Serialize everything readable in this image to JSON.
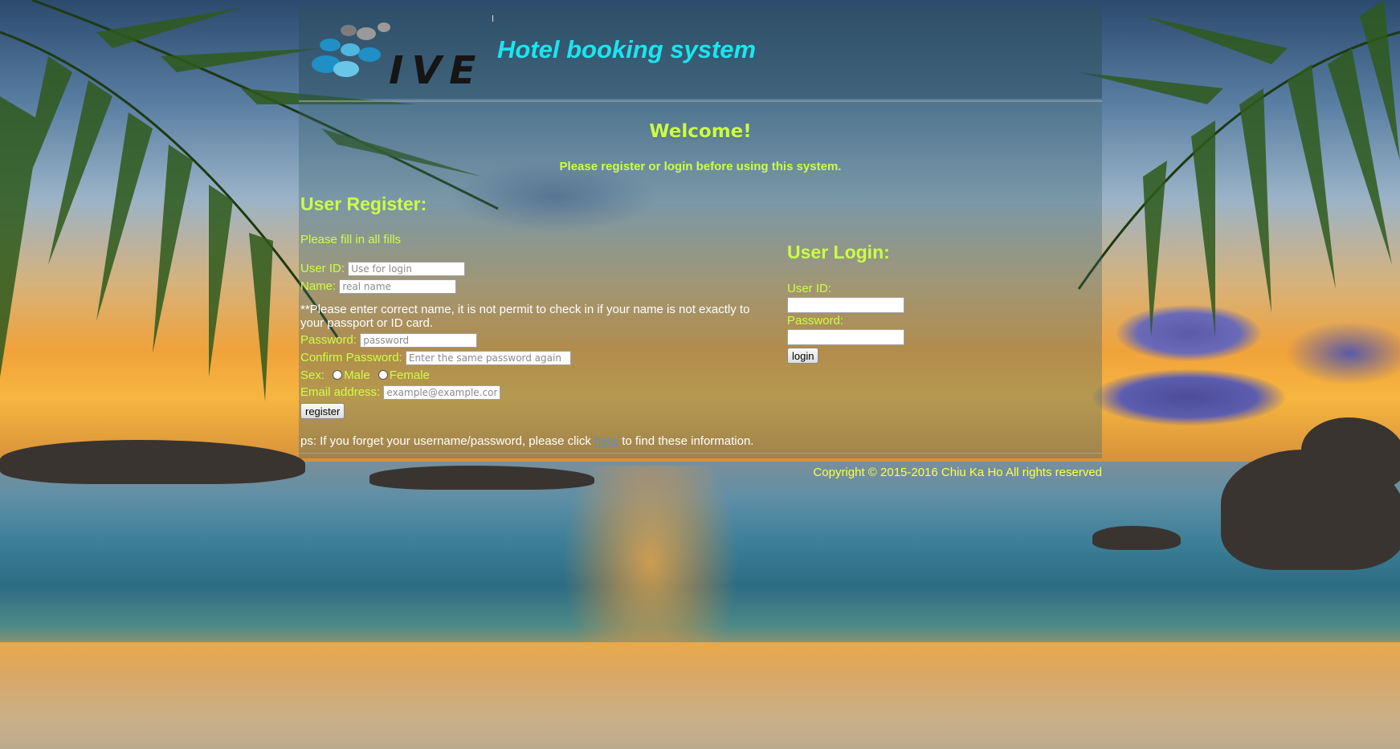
{
  "header": {
    "logo_text": "IVE",
    "title": "Hotel booking system"
  },
  "welcome": {
    "heading": "Welcome!",
    "subtitle": "Please register or login before using this system."
  },
  "register": {
    "title": "User Register:",
    "instruction": "Please fill in all fills",
    "user_id_label": "User ID:",
    "user_id_placeholder": "Use for login",
    "name_label": "Name:",
    "name_placeholder": "real name",
    "name_note": "**Please enter correct name, it is not permit to check in if your name is not exactly to your passport or ID card.",
    "password_label": "Password:",
    "password_placeholder": "password",
    "confirm_label": "Confirm Password:",
    "confirm_placeholder": "Enter the same password again",
    "sex_label": "Sex:",
    "sex_options": [
      "Male",
      "Female"
    ],
    "email_label": "Email address:",
    "email_placeholder": "example@example.com",
    "submit_label": "register"
  },
  "login": {
    "title": "User Login:",
    "user_id_label": "User ID:",
    "password_label": "Password:",
    "submit_label": "login"
  },
  "ps": {
    "before": "ps: If you forget your username/password, please click ",
    "link_text": "here",
    "after": " to find these information."
  },
  "footer": {
    "copyright": "Copyright © 2015-2016 Chiu Ka Ho All rights reserved"
  },
  "colors": {
    "label_green": "#ccff44",
    "title_cyan": "#19e6f0",
    "copyright_yellow": "#ffff44"
  }
}
